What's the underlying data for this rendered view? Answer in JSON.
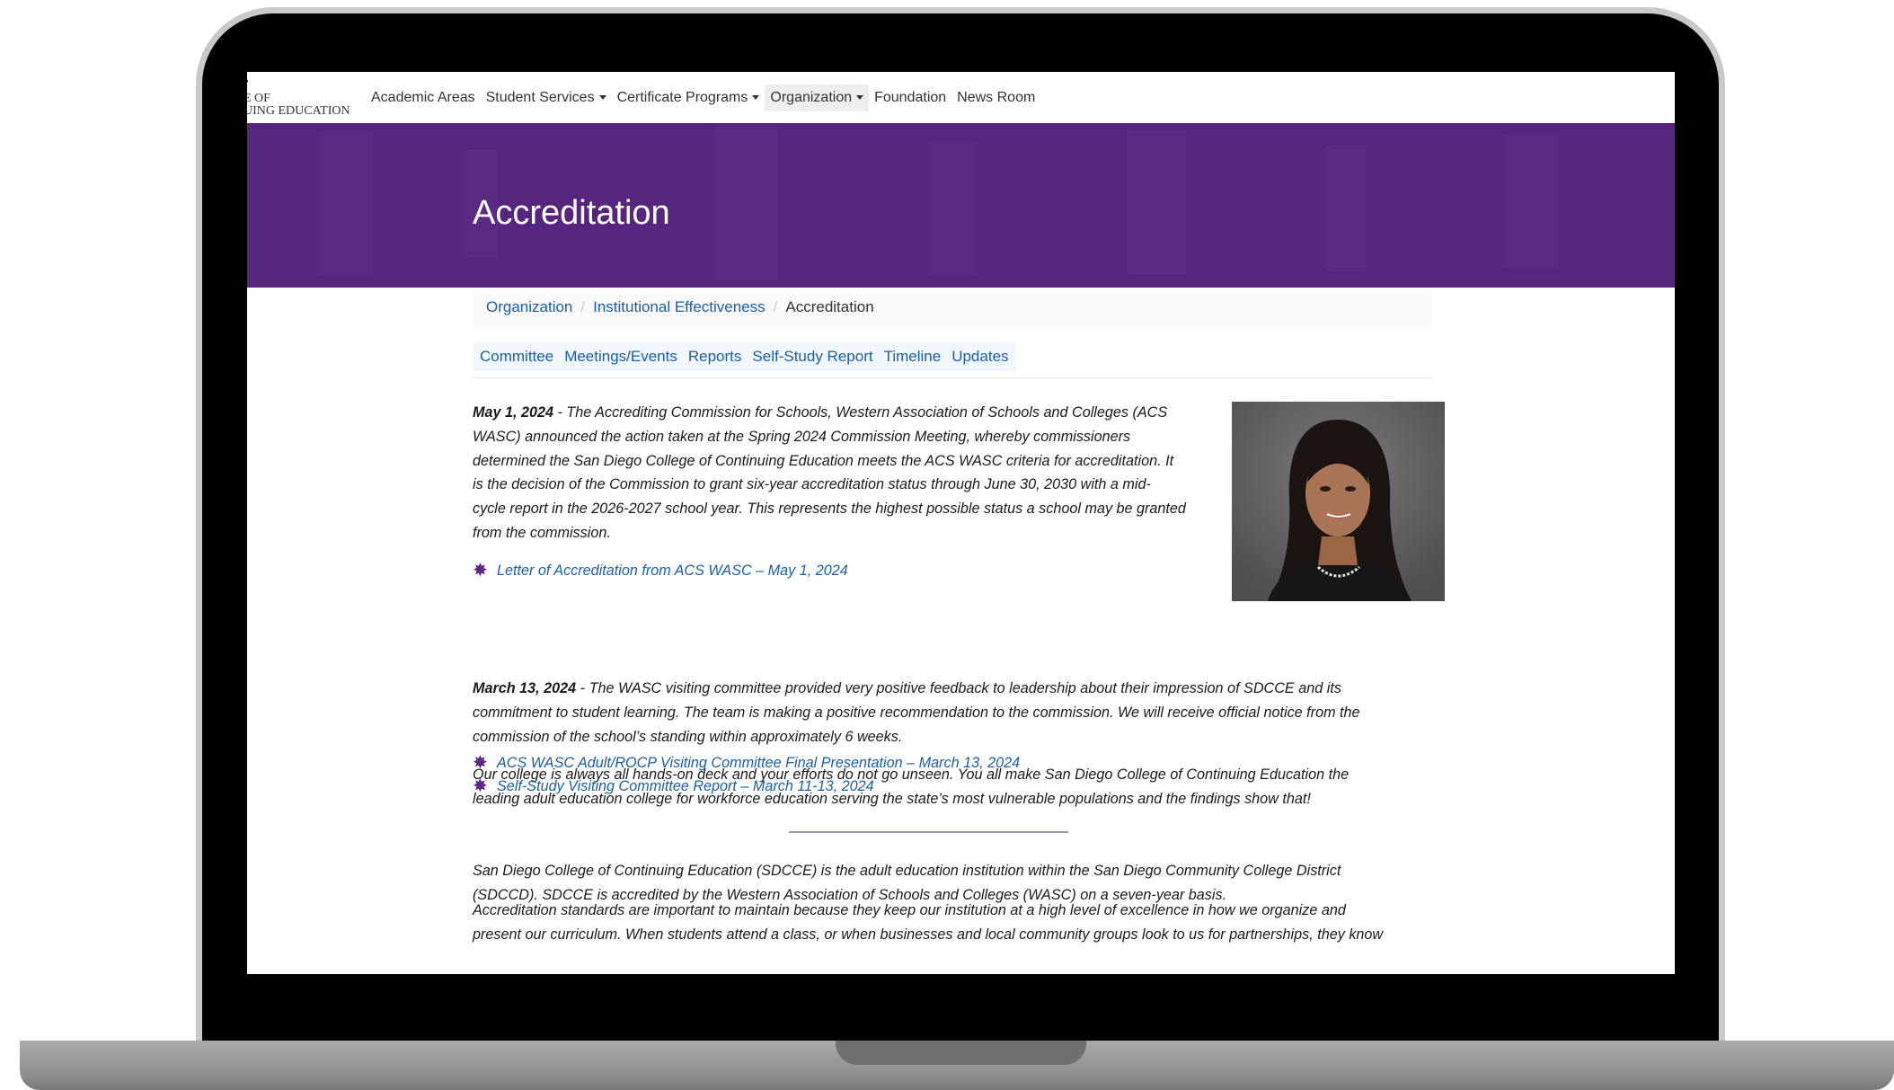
{
  "nav": {
    "logo_line1": "E OF",
    "logo_line2": "UING EDUCATION",
    "items": [
      {
        "label": "Academic Areas",
        "dropdown": false,
        "active": false
      },
      {
        "label": "Student Services",
        "dropdown": true,
        "active": false
      },
      {
        "label": "Certificate Programs",
        "dropdown": true,
        "active": false
      },
      {
        "label": "Organization",
        "dropdown": true,
        "active": true
      },
      {
        "label": "Foundation",
        "dropdown": false,
        "active": false
      },
      {
        "label": "News Room",
        "dropdown": false,
        "active": false
      }
    ]
  },
  "banner": {
    "title": "Accreditation",
    "color": "#56267f"
  },
  "breadcrumb": {
    "items": [
      "Organization",
      "Institutional Effectiveness"
    ],
    "current": "Accreditation"
  },
  "tabs": [
    "Committee",
    "Meetings/Events",
    "Reports",
    "Self-Study Report",
    "Timeline",
    "Updates"
  ],
  "content": {
    "p1_date": "May 1, 2024",
    "p1_lines": [
      " - The Accrediting Commission for Schools, Western Association of Schools and Colleges (ACS",
      "WASC) announced the action taken at the Spring 2024 Commission Meeting, whereby commissioners",
      "determined the San Diego College of Continuing Education meets the ACS WASC criteria for accreditation. It",
      "is the decision of the Commission to grant six-year accreditation status through June 30, 2030 with a mid-",
      "cycle report in the 2026-2027 school year. This represents the highest possible status a school may be granted",
      "from the commission."
    ],
    "link1": "Letter of Accreditation from ACS WASC – May 1, 2024",
    "p2_date": "March 13, 2024",
    "p2_lines": [
      " - The WASC visiting committee provided very positive feedback to leadership about their impression of SDCCE and its",
      "commitment to student learning. The team is making a positive recommendation to the commission. We will receive official notice from the",
      "commission of the school’s standing within approximately 6 weeks."
    ],
    "p3_lines": [
      "Our college is always all hands-on deck and your efforts do not go unseen. You all make San Diego College of Continuing Education the",
      "leading adult education college for workforce education serving the state’s most vulnerable populations and the findings show that!"
    ],
    "link2": "ACS WASC Adult/ROCP Visiting Committee Final Presentation – March 13, 2024",
    "link3": "Self-Study Visiting Committee Report – March 11-13, 2024",
    "p4_lines": [
      "San Diego College of Continuing Education (SDCCE) is the adult education institution within the San Diego Community College District",
      "(SDCCD). SDCCE is accredited by the Western Association of Schools and Colleges (WASC) on a seven-year basis."
    ],
    "p5_lines": [
      "Accreditation standards are important to maintain because they keep our institution at a high level of excellence in how we organize and",
      "present our curriculum. When students attend a class, or when businesses and local community groups look to us for partnerships, they know"
    ]
  },
  "colors": {
    "link": "#1a5fa8",
    "bullet": "#5a2a86",
    "banner": "#56267f"
  }
}
